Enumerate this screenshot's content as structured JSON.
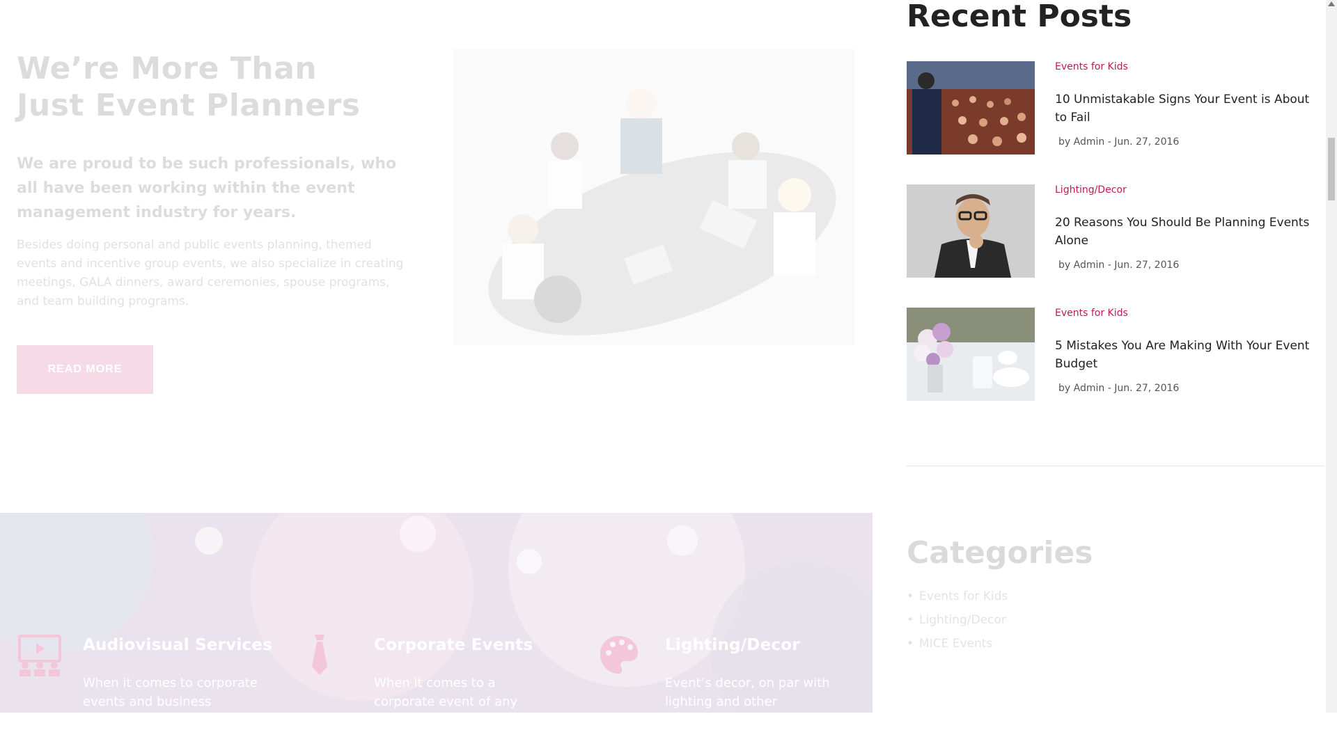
{
  "about": {
    "title_line1": "We’re More Than",
    "title_line2": "Just Event Planners",
    "lead": "We are proud to be such professionals, who all have been working within the event management industry for years.",
    "text": "Besides doing personal and public events planning, themed events and incentive group events, we also specialize in creating meetings, GALA dinners, award ceremonies, spouse programs, and team building programs.",
    "read_more_label": "READ MORE"
  },
  "services": [
    {
      "icon": "audiovisual-icon",
      "title": "Audiovisual Services",
      "text": "When it comes to corporate events and business"
    },
    {
      "icon": "tie-icon",
      "title": "Corporate Events",
      "text": "When it comes to a corporate event of any scale,"
    },
    {
      "icon": "palette-icon",
      "title": "Lighting/Decor",
      "text": "Event’s decor, on par with lighting and other audiovisual"
    }
  ],
  "sidebar": {
    "recent_posts_title": "Recent Posts",
    "posts": [
      {
        "category": "Events for Kids",
        "title": "10 Unmistakable Signs Your Event is About to Fail",
        "meta": "by Admin - Jun. 27, 2016"
      },
      {
        "category": "Lighting/Decor",
        "title": "20 Reasons You Should Be Planning Events Alone",
        "meta": "by Admin - Jun. 27, 2016"
      },
      {
        "category": "Events for Kids",
        "title": "5 Mistakes You Are Making With Your Event Budget",
        "meta": "by Admin - Jun. 27, 2016"
      }
    ],
    "categories_title": "Categories",
    "categories": [
      "Events for Kids",
      "Lighting/Decor",
      "MICE Events"
    ]
  },
  "colors": {
    "accent": "#c2185b",
    "heading": "#222222",
    "services_bg": "#6d3a7f"
  }
}
